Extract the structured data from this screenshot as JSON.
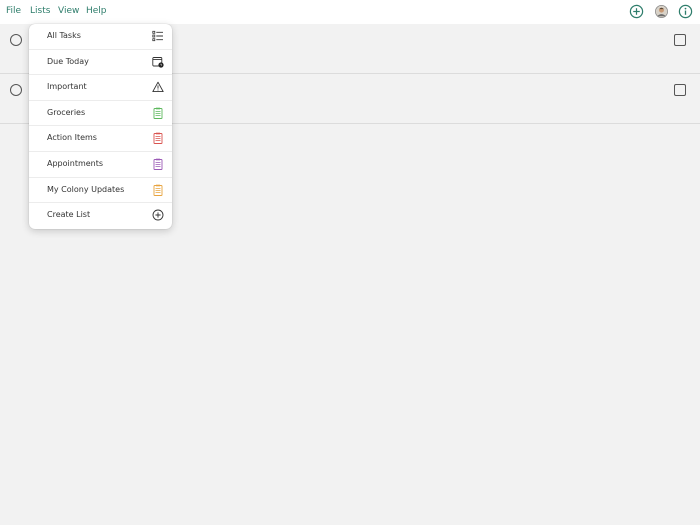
{
  "menubar": {
    "items": [
      "File",
      "Lists",
      "View",
      "Help"
    ]
  },
  "toolbar": {
    "icons": [
      "add-icon",
      "avatar",
      "info-icon"
    ],
    "accent": "#2e7d6b"
  },
  "task_rows": [
    {
      "completed": false,
      "flagged": false
    },
    {
      "completed": false,
      "flagged": false
    }
  ],
  "lists_menu": {
    "items": [
      {
        "label": "All Tasks",
        "icon": "list-icon",
        "color": "#333333"
      },
      {
        "label": "Due Today",
        "icon": "calendar-clock-icon",
        "color": "#333333"
      },
      {
        "label": "Important",
        "icon": "warning-icon",
        "color": "#333333"
      },
      {
        "label": "Groceries",
        "icon": "clipboard-icon",
        "color": "#5cb85c"
      },
      {
        "label": "Action Items",
        "icon": "clipboard-icon",
        "color": "#d9534f"
      },
      {
        "label": "Appointments",
        "icon": "clipboard-icon",
        "color": "#9b59b6"
      },
      {
        "label": "My Colony Updates",
        "icon": "clipboard-icon",
        "color": "#e8a33d"
      },
      {
        "label": "Create List",
        "icon": "add-circle-icon",
        "color": "#333333"
      }
    ]
  }
}
